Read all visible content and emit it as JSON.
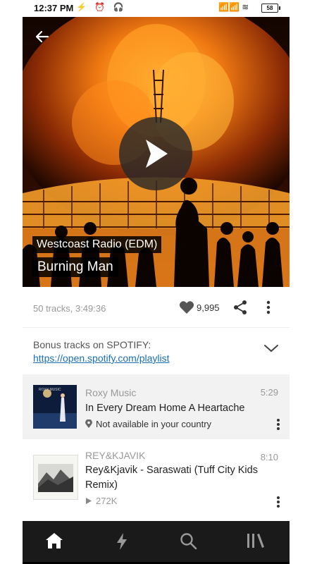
{
  "status": {
    "time": "12:37 PM",
    "left_icons": "⚡ ⏰ 🎧",
    "right_icons": "📶📶 ≋",
    "battery": "58"
  },
  "hero": {
    "station": "Westcoast Radio (EDM)",
    "title": "Burning Man"
  },
  "meta": {
    "track_info": "50 tracks, 3:49:36",
    "likes": "9,995"
  },
  "description": {
    "text": "Bonus tracks on SPOTIFY:",
    "link": "https://open.spotify.com/playlist"
  },
  "tracks": [
    {
      "artist": "Roxy Music",
      "title": "In Every Dream Home A Heartache",
      "duration": "5:29",
      "sub": "Not available in your country",
      "artwork_text": "ROXY MUSIC"
    },
    {
      "artist": "REY&KJAVIK",
      "title": "Rey&Kjavik - Saraswati (Tuff City Kids Remix)",
      "duration": "8:10",
      "sub": "272K"
    }
  ],
  "nav": [
    "home-icon",
    "stream-icon",
    "search-icon",
    "library-icon"
  ]
}
